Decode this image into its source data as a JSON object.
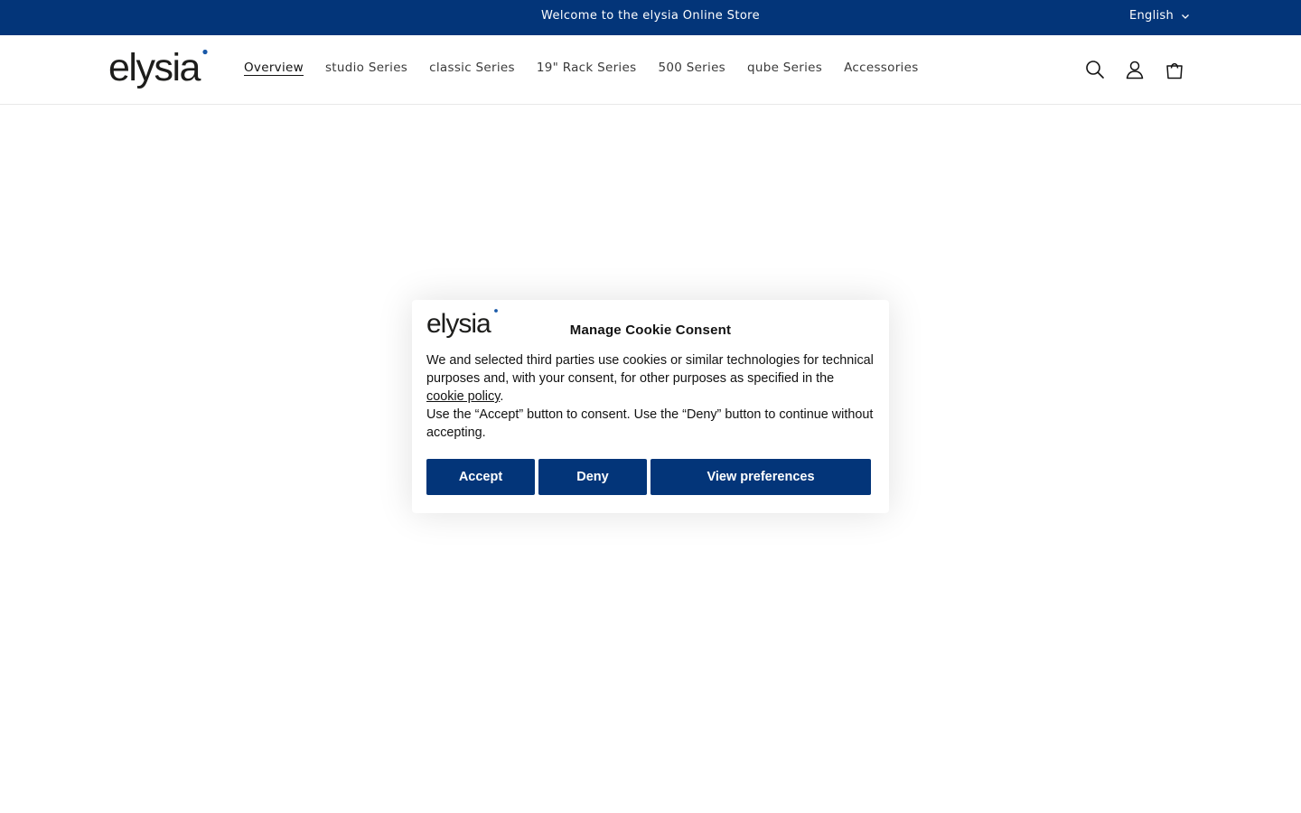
{
  "announcement": {
    "message": "Welcome to the elysia Online Store",
    "language": "English"
  },
  "header": {
    "logo_text": "elysia",
    "nav": [
      {
        "label": "Overview",
        "active": true
      },
      {
        "label": "studio Series",
        "active": false
      },
      {
        "label": "classic Series",
        "active": false
      },
      {
        "label": "19\" Rack Series",
        "active": false
      },
      {
        "label": "500 Series",
        "active": false
      },
      {
        "label": "qube Series",
        "active": false
      },
      {
        "label": "Accessories",
        "active": false
      }
    ],
    "icons": [
      "search-icon",
      "account-icon",
      "cart-icon"
    ]
  },
  "cookie_modal": {
    "logo_text": "elysia",
    "title": "Manage Cookie Consent",
    "body_part1": "We and selected third parties use cookies or similar technologies for technical purposes and, with your consent, for other purposes as specified in the ",
    "policy_link": "cookie policy",
    "body_part2": ".",
    "body_line2": "Use the “Accept” button to consent. Use the “Deny” button to continue without accepting.",
    "accept_label": "Accept",
    "deny_label": "Deny",
    "preferences_label": "View preferences"
  },
  "colors": {
    "brand_blue": "#033579",
    "text": "#121212",
    "logo_dot": "#1a5aa8"
  }
}
